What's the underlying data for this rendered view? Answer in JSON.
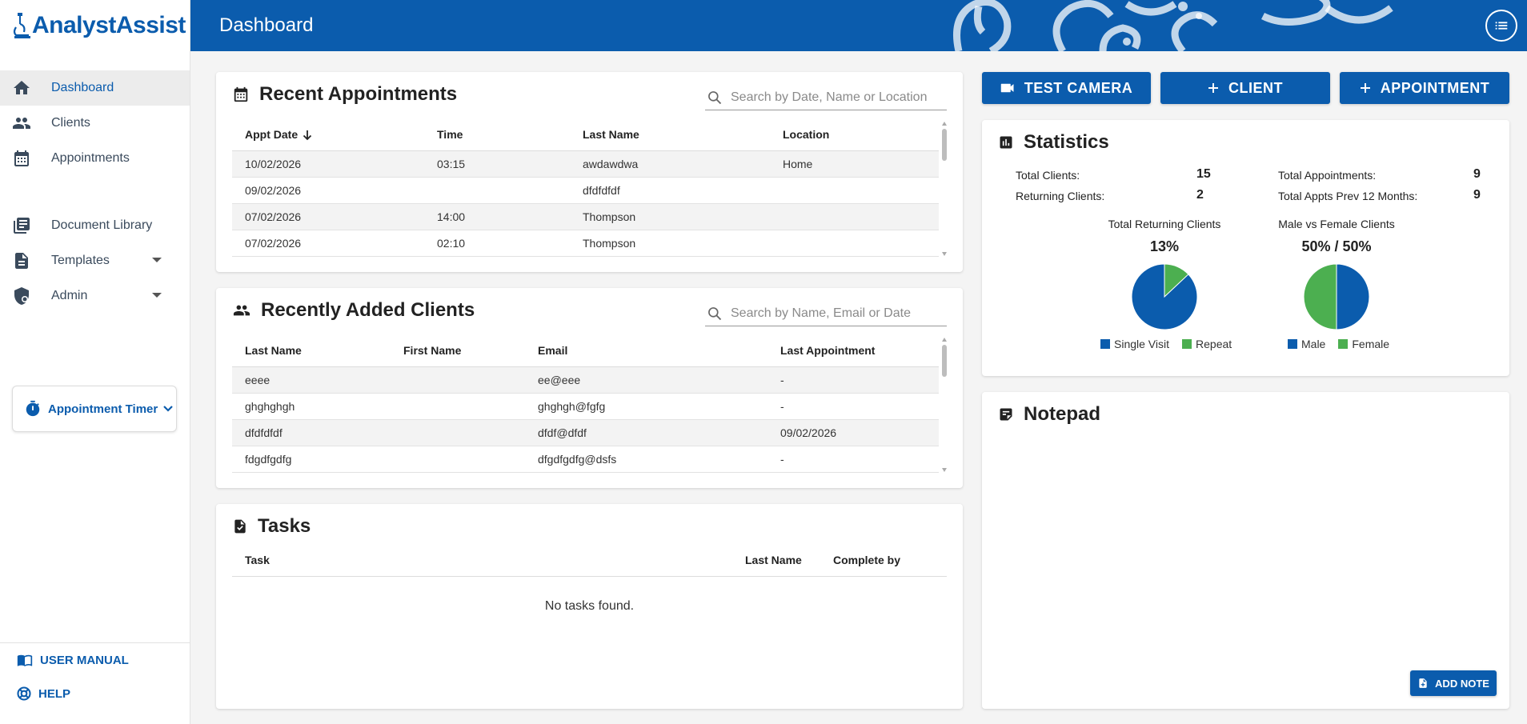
{
  "app": {
    "logo_part1": "Analyst",
    "logo_part2": "Assist"
  },
  "header": {
    "title": "Dashboard",
    "menu_icon": "list-icon"
  },
  "sidebar": {
    "items": [
      {
        "label": "Dashboard",
        "icon": "home-icon"
      },
      {
        "label": "Clients",
        "icon": "people-icon"
      },
      {
        "label": "Appointments",
        "icon": "calendar-icon"
      },
      {
        "label": "Document Library",
        "icon": "library-icon"
      },
      {
        "label": "Templates",
        "icon": "document-icon"
      },
      {
        "label": "Admin",
        "icon": "admin-shield-icon"
      }
    ],
    "timer_label": "Appointment Timer",
    "user_manual": "USER MANUAL",
    "help": "HELP"
  },
  "buttons": {
    "test_camera": "TEST CAMERA",
    "client": "CLIENT",
    "appointment": "APPOINTMENT"
  },
  "recent_appointments": {
    "title": "Recent Appointments",
    "search_placeholder": "Search by Date, Name or Location",
    "columns": [
      "Appt Date",
      "Time",
      "Last Name",
      "Location"
    ],
    "rows": [
      [
        "10/02/2026",
        "03:15",
        "awdawdwa",
        "Home"
      ],
      [
        "09/02/2026",
        "",
        "dfdfdfdf",
        ""
      ],
      [
        "07/02/2026",
        "14:00",
        "Thompson",
        ""
      ],
      [
        "07/02/2026",
        "02:10",
        "Thompson",
        ""
      ]
    ]
  },
  "recent_clients": {
    "title": "Recently Added Clients",
    "search_placeholder": "Search by Name, Email or Date",
    "columns": [
      "Last Name",
      "First Name",
      "Email",
      "Last Appointment"
    ],
    "rows": [
      [
        "eeee",
        "",
        "ee@eee",
        "-"
      ],
      [
        "ghghghgh",
        "",
        "ghghgh@fgfg",
        "-"
      ],
      [
        "dfdfdfdf",
        "",
        "dfdf@dfdf",
        "09/02/2026"
      ],
      [
        "fdgdfgdfg",
        "",
        "dfgdfgdfg@dsfs",
        "-"
      ]
    ]
  },
  "tasks": {
    "title": "Tasks",
    "columns": [
      "Task",
      "Last Name",
      "Complete by"
    ],
    "empty_text": "No tasks found."
  },
  "statistics": {
    "title": "Statistics",
    "total_clients_label": "Total Clients:",
    "total_clients": "15",
    "returning_clients_label": "Returning Clients:",
    "returning_clients": "2",
    "total_appts_label": "Total Appointments:",
    "total_appts": "9",
    "total_appts_prev_label": "Total Appts Prev 12 Months:",
    "total_appts_prev": "9",
    "pie1": {
      "title": "Total Returning Clients",
      "pct": "13%",
      "legend": [
        "Single Visit",
        "Repeat"
      ],
      "values": [
        87,
        13
      ]
    },
    "pie2": {
      "title": "Male vs Female Clients",
      "pct": "50% / 50%",
      "legend": [
        "Male",
        "Female"
      ],
      "values": [
        50,
        50
      ]
    },
    "colors": {
      "primary": "#0b5cad",
      "secondary": "#4caf50"
    }
  },
  "notepad": {
    "title": "Notepad",
    "add_note": "ADD NOTE"
  }
}
